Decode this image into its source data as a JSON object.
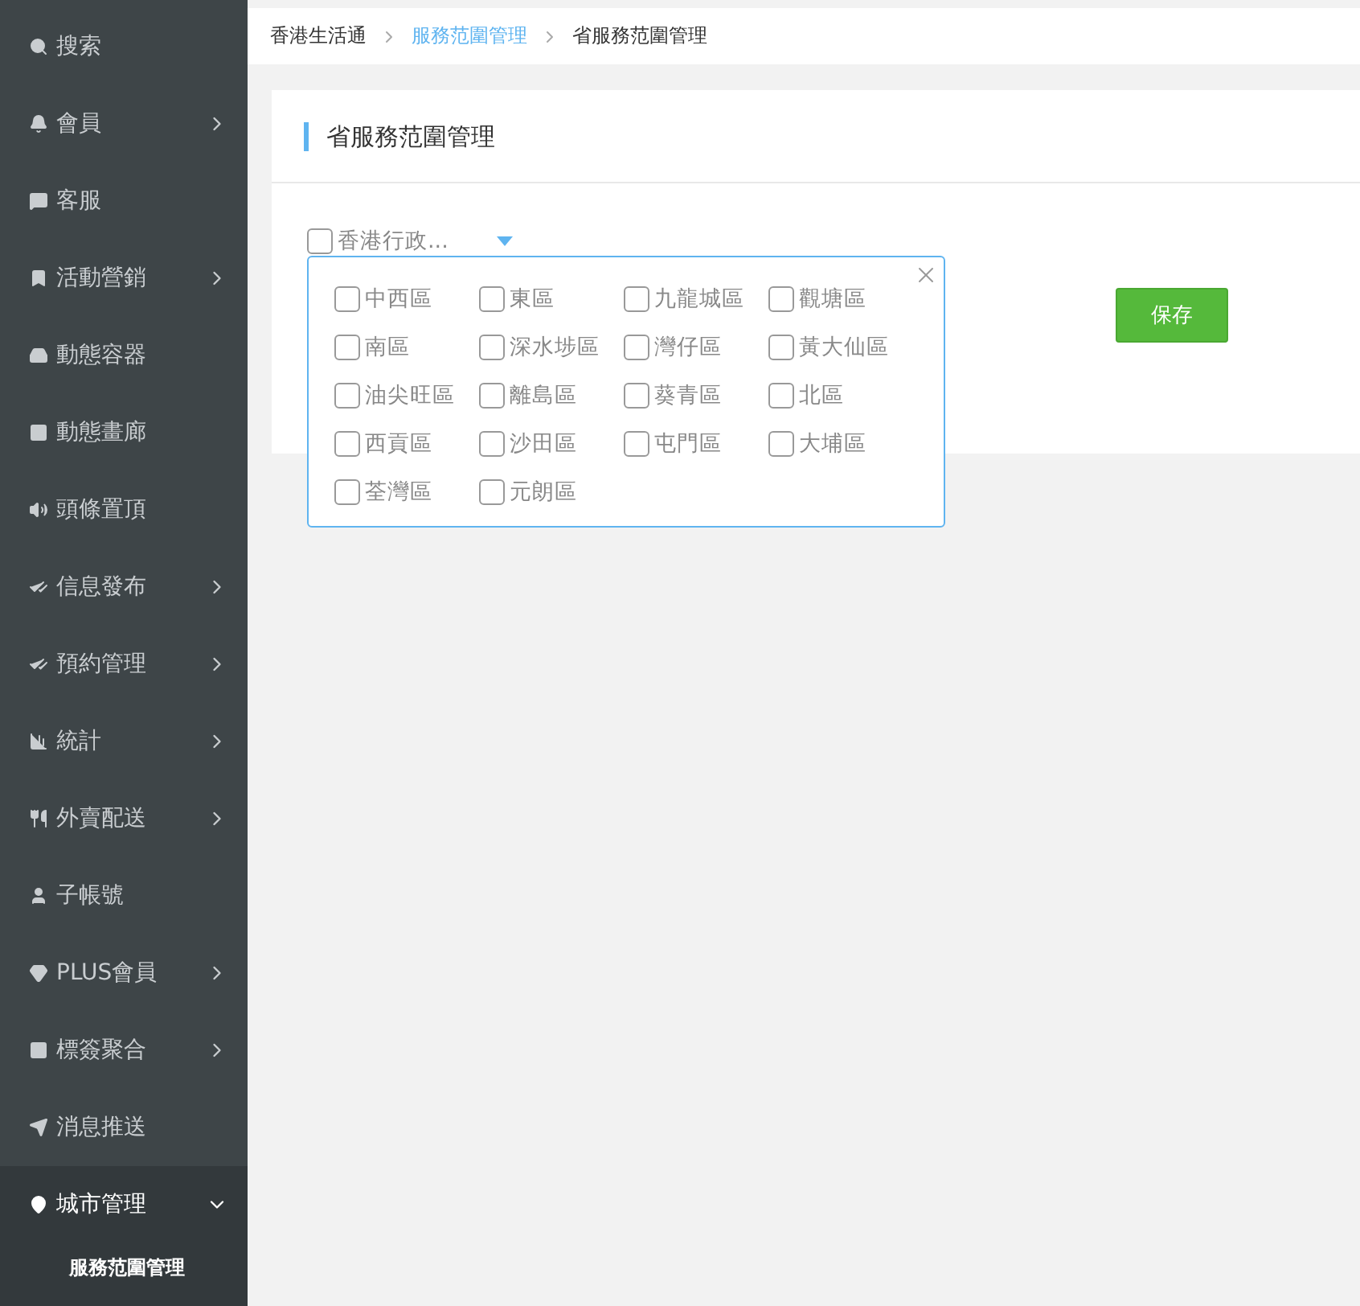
{
  "sidebar": {
    "items": [
      {
        "label": "搜索",
        "expandable": false,
        "expanded": false,
        "selected": false
      },
      {
        "label": "會員",
        "expandable": true,
        "expanded": false,
        "selected": false
      },
      {
        "label": "客服",
        "expandable": false,
        "expanded": false,
        "selected": false
      },
      {
        "label": "活動營銷",
        "expandable": true,
        "expanded": false,
        "selected": false
      },
      {
        "label": "動態容器",
        "expandable": false,
        "expanded": false,
        "selected": false
      },
      {
        "label": "動態畫廊",
        "expandable": false,
        "expanded": false,
        "selected": false
      },
      {
        "label": "頭條置頂",
        "expandable": false,
        "expanded": false,
        "selected": false
      },
      {
        "label": "信息發布",
        "expandable": true,
        "expanded": false,
        "selected": false
      },
      {
        "label": "預約管理",
        "expandable": true,
        "expanded": false,
        "selected": false
      },
      {
        "label": "統計",
        "expandable": true,
        "expanded": false,
        "selected": false
      },
      {
        "label": "外賣配送",
        "expandable": true,
        "expanded": false,
        "selected": false
      },
      {
        "label": "子帳號",
        "expandable": false,
        "expanded": false,
        "selected": false
      },
      {
        "label": "PLUS會員",
        "expandable": true,
        "expanded": false,
        "selected": false
      },
      {
        "label": "標簽聚合",
        "expandable": true,
        "expanded": false,
        "selected": false
      },
      {
        "label": "消息推送",
        "expandable": false,
        "expanded": false,
        "selected": false
      },
      {
        "label": "城市管理",
        "expandable": true,
        "expanded": true,
        "selected": true,
        "children": [
          {
            "label": "服務范圍管理",
            "selected": true
          }
        ]
      }
    ]
  },
  "breadcrumb": [
    {
      "label": "香港生活通",
      "link": false
    },
    {
      "label": "服務范圍管理",
      "link": true
    },
    {
      "label": "省服務范圍管理",
      "link": false
    }
  ],
  "card": {
    "title": "省服務范圍管理",
    "region_select": {
      "label": "香港行政...",
      "checked": false,
      "expanded": true,
      "options": [
        {
          "label": "中西區",
          "checked": false
        },
        {
          "label": "東區",
          "checked": false
        },
        {
          "label": "九龍城區",
          "checked": false
        },
        {
          "label": "觀塘區",
          "checked": false
        },
        {
          "label": "南區",
          "checked": false
        },
        {
          "label": "深水埗區",
          "checked": false
        },
        {
          "label": "灣仔區",
          "checked": false
        },
        {
          "label": "黃大仙區",
          "checked": false
        },
        {
          "label": "油尖旺區",
          "checked": false
        },
        {
          "label": "離島區",
          "checked": false
        },
        {
          "label": "葵青區",
          "checked": false
        },
        {
          "label": "北區",
          "checked": false
        },
        {
          "label": "西貢區",
          "checked": false
        },
        {
          "label": "沙田區",
          "checked": false
        },
        {
          "label": "屯門區",
          "checked": false
        },
        {
          "label": "大埔區",
          "checked": false
        },
        {
          "label": "荃灣區",
          "checked": false
        },
        {
          "label": "元朗區",
          "checked": false
        }
      ]
    },
    "save_button": "保存"
  }
}
